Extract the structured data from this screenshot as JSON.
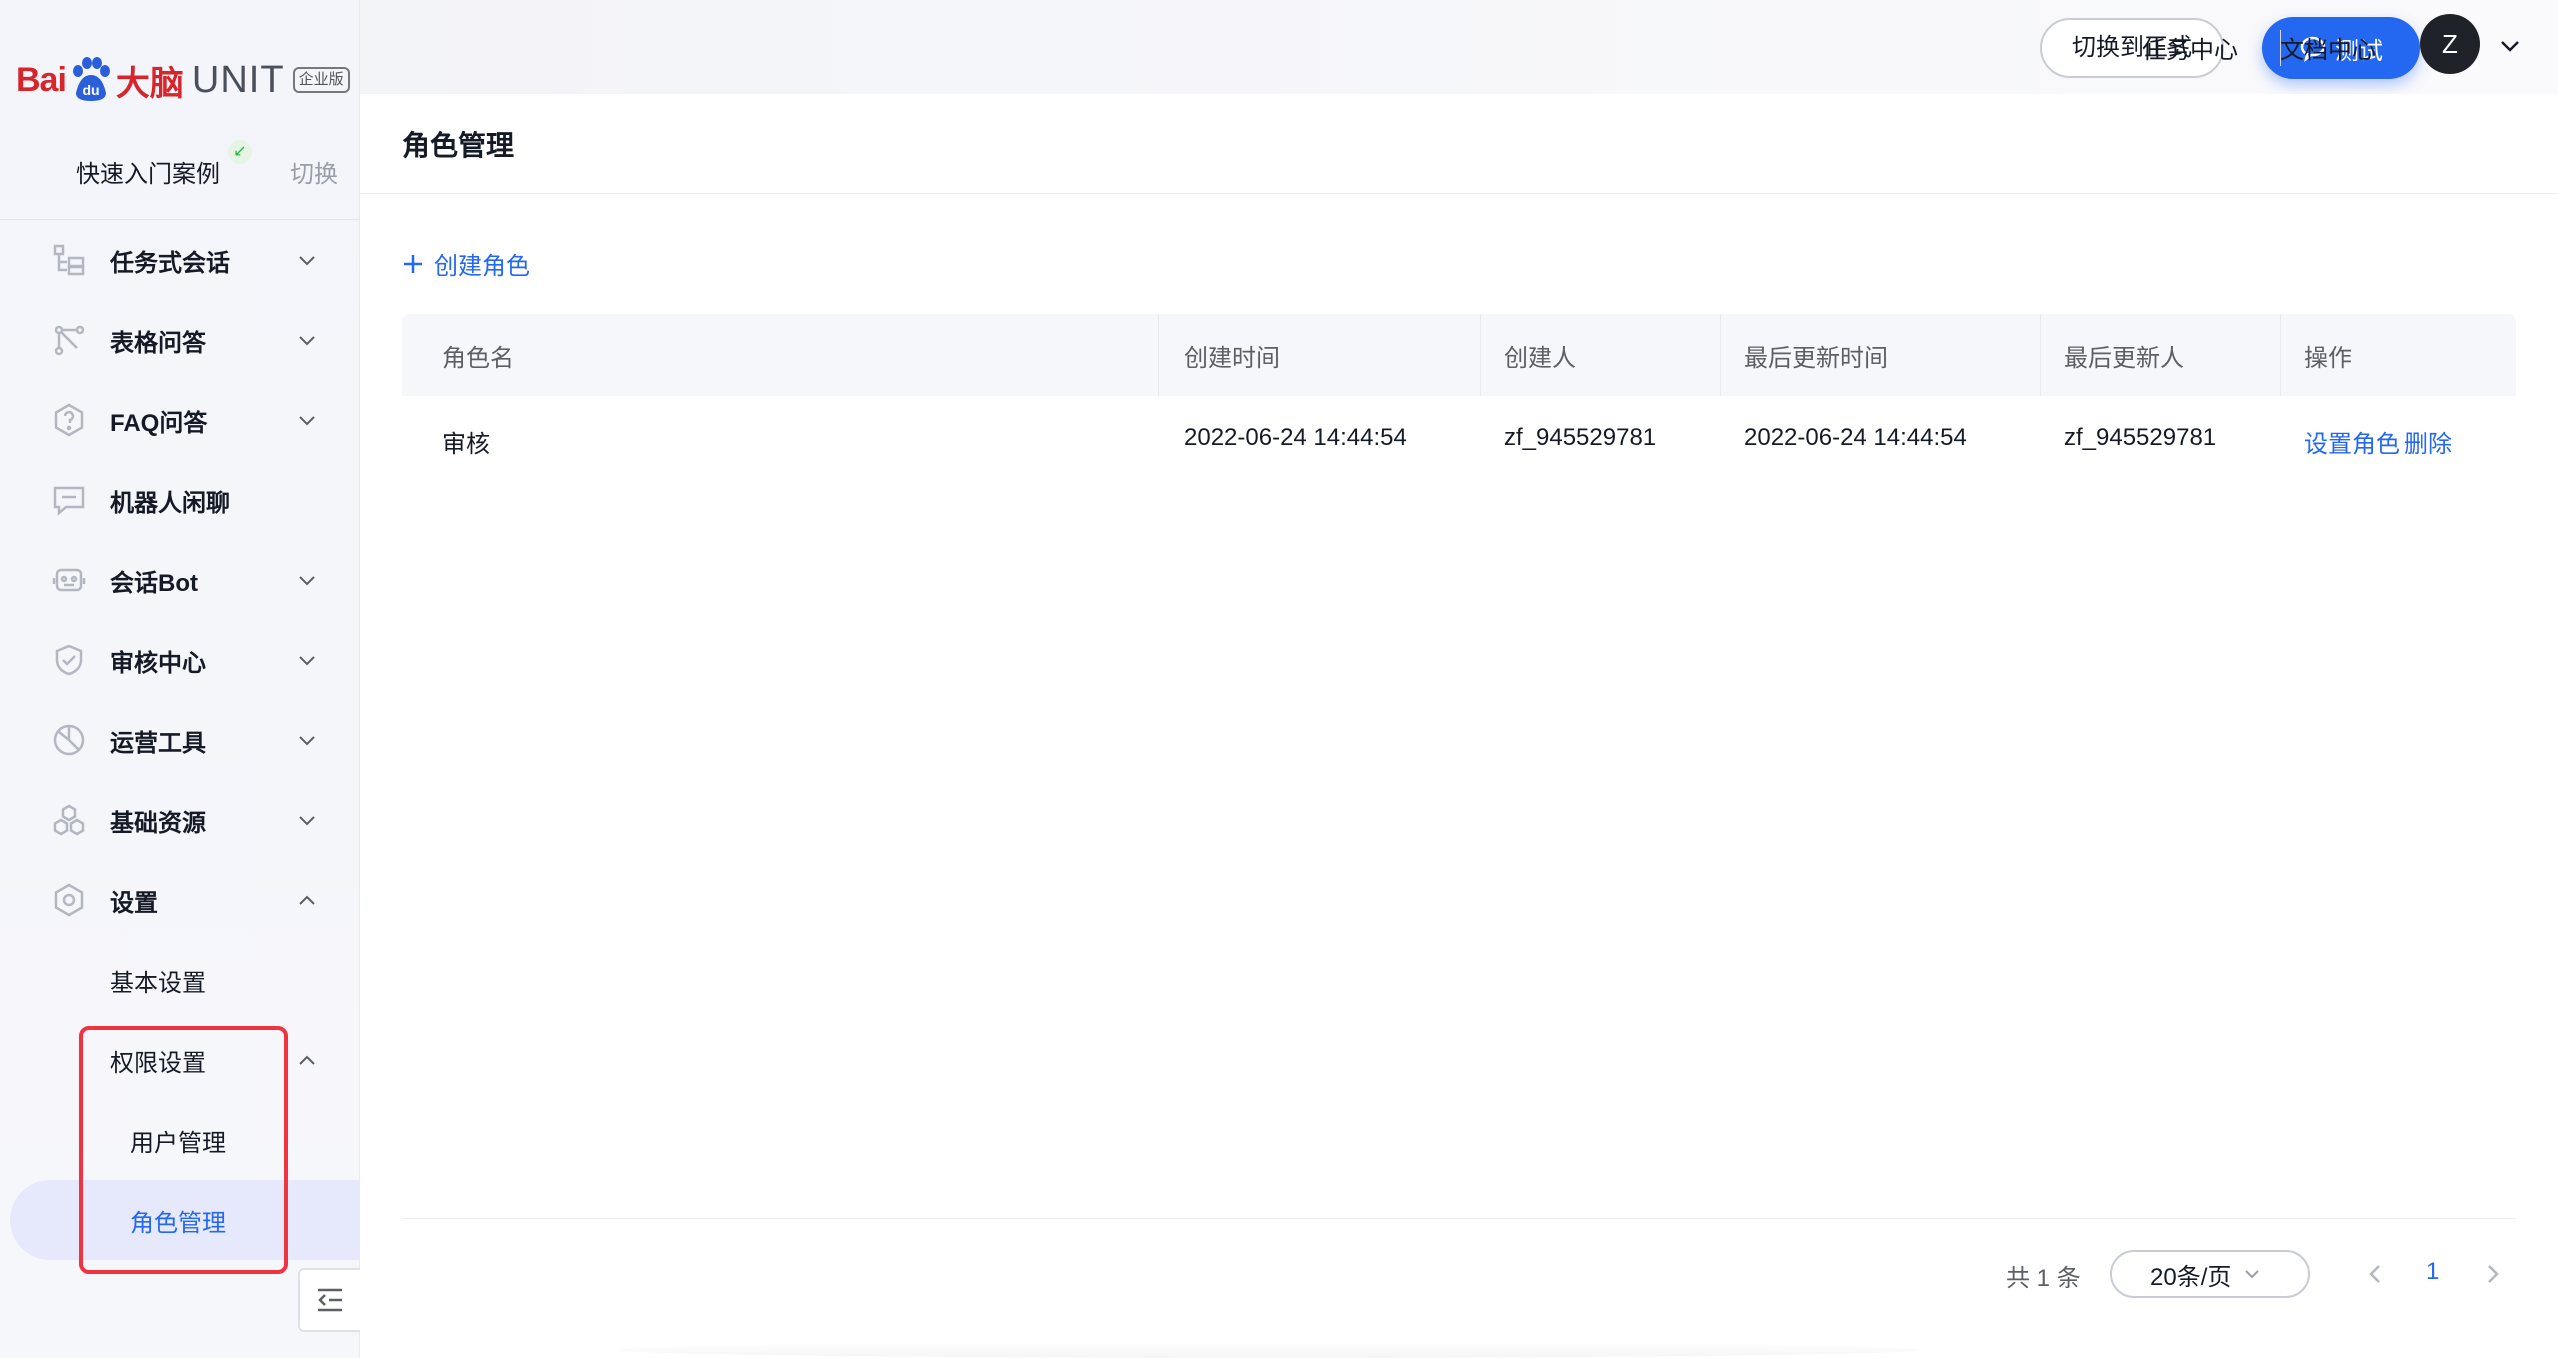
{
  "brand": {
    "logo_text_bai": "Bai",
    "logo_text_du": "du",
    "logo_text_danao": "大脑",
    "product": "UNIT",
    "edition_badge": "企业版",
    "brand_color": "#d6262b"
  },
  "project": {
    "name": "快速入门案例",
    "switch_label": "切换"
  },
  "sidebar": {
    "items": [
      {
        "label": "任务式会话",
        "icon": "task-dialog-icon",
        "expandable": true
      },
      {
        "label": "表格问答",
        "icon": "table-qa-icon",
        "expandable": true
      },
      {
        "label": "FAQ问答",
        "icon": "faq-icon",
        "expandable": true
      },
      {
        "label": "机器人闲聊",
        "icon": "chat-icon",
        "expandable": false
      },
      {
        "label": "会话Bot",
        "icon": "bot-icon",
        "expandable": true
      },
      {
        "label": "审核中心",
        "icon": "shield-icon",
        "expandable": true
      },
      {
        "label": "运营工具",
        "icon": "operation-icon",
        "expandable": true
      },
      {
        "label": "基础资源",
        "icon": "resource-icon",
        "expandable": true
      },
      {
        "label": "设置",
        "icon": "settings-icon",
        "expanded": true
      }
    ],
    "settings_children": {
      "basic": "基本设置",
      "permission": "权限设置",
      "permission_children": [
        "用户管理",
        "角色管理"
      ]
    },
    "active_item": "角色管理"
  },
  "topbar": {
    "switch_formal_label": "切换到正式",
    "test_label": "测试",
    "task_center_label": "任务中心",
    "doc_center_label": "文档中心",
    "avatar_initial": "Z"
  },
  "page": {
    "title": "角色管理",
    "create_label": "创建角色"
  },
  "table": {
    "columns": [
      "角色名",
      "创建时间",
      "创建人",
      "最后更新时间",
      "最后更新人",
      "操作"
    ],
    "rows": [
      {
        "role_name": "审核",
        "created_at": "2022-06-24 14:44:54",
        "creator": "zf_945529781",
        "updated_at": "2022-06-24 14:44:54",
        "updater": "zf_945529781",
        "actions": [
          "设置角色",
          "删除"
        ]
      }
    ]
  },
  "pagination": {
    "total_text": "共 1 条",
    "page_size": "20条/页",
    "current_page": "1"
  },
  "colors": {
    "accent": "#2468f2",
    "highlight_border": "#ef3340"
  }
}
